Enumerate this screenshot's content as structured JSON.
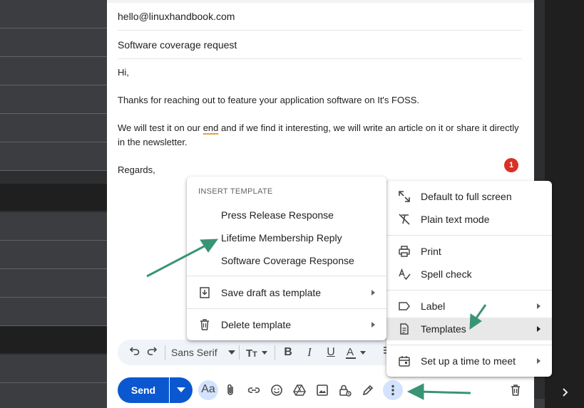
{
  "compose": {
    "to": "hello@linuxhandbook.com",
    "subject": "Software coverage request",
    "body_lines": [
      "Hi,",
      "Thanks for reaching out to feature your application software on It's FOSS.",
      "We will test it on our ",
      "end",
      " and if we find it interesting, we will write an article on it or share it directly in the newsletter.",
      "Regards,"
    ],
    "badge_count": "1"
  },
  "toolbar": {
    "font_name": "Sans Serif",
    "send_label": "Send",
    "aa_label": "Aa"
  },
  "template_menu": {
    "heading": "INSERT TEMPLATE",
    "templates": [
      "Press Release Response",
      "Lifetime Membership Reply",
      "Software Coverage Response"
    ],
    "save_draft": "Save draft as template",
    "delete_template": "Delete template"
  },
  "more_menu": {
    "items": [
      "Default to full screen",
      "Plain text mode",
      "Print",
      "Spell check",
      "Label",
      "Templates",
      "Set up a time to meet"
    ]
  },
  "colors": {
    "accent": "#0b57d0",
    "annotation": "#3a9474",
    "badge": "#d93025"
  },
  "icons": [
    "fullscreen-icon",
    "plain-text-icon",
    "print-icon",
    "spell-check-icon",
    "label-icon",
    "templates-icon",
    "calendar-icon",
    "save-template-icon",
    "trash-icon",
    "undo-icon",
    "redo-icon",
    "text-size-icon",
    "bold-icon",
    "italic-icon",
    "underline-icon",
    "text-color-icon",
    "attach-icon",
    "link-icon",
    "emoji-icon",
    "drive-icon",
    "image-icon",
    "confidential-icon",
    "signature-icon",
    "more-options-icon",
    "discard-icon"
  ]
}
